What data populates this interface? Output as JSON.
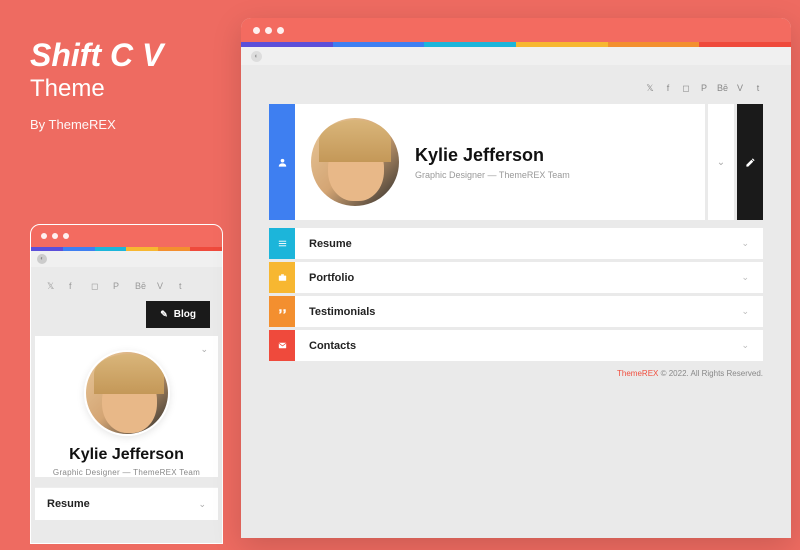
{
  "theme": {
    "title": "Shift C V",
    "subtitle": "Theme",
    "author": "By ThemeREX"
  },
  "profile": {
    "name": "Kylie Jefferson",
    "role": "Graphic Designer — ThemeREX Team"
  },
  "blog_label": "Blog",
  "sections": [
    {
      "label": "Resume",
      "color": "#1cb5da",
      "icon": "menu"
    },
    {
      "label": "Portfolio",
      "color": "#f7b731",
      "icon": "briefcase"
    },
    {
      "label": "Testimonials",
      "color": "#f38f2f",
      "icon": "quote"
    },
    {
      "label": "Contacts",
      "color": "#ef4a3c",
      "icon": "mail"
    }
  ],
  "socials": [
    "twitter",
    "facebook",
    "instagram",
    "pinterest",
    "behance",
    "vimeo",
    "tumblr"
  ],
  "footer": {
    "brand": "ThemeREX",
    "rest": " © 2022. All Rights Reserved."
  },
  "stripe_colors": [
    "#5b4fd9",
    "#3e7ff1",
    "#1cb5da",
    "#f7b731",
    "#f38f2f",
    "#ef4a3c"
  ]
}
